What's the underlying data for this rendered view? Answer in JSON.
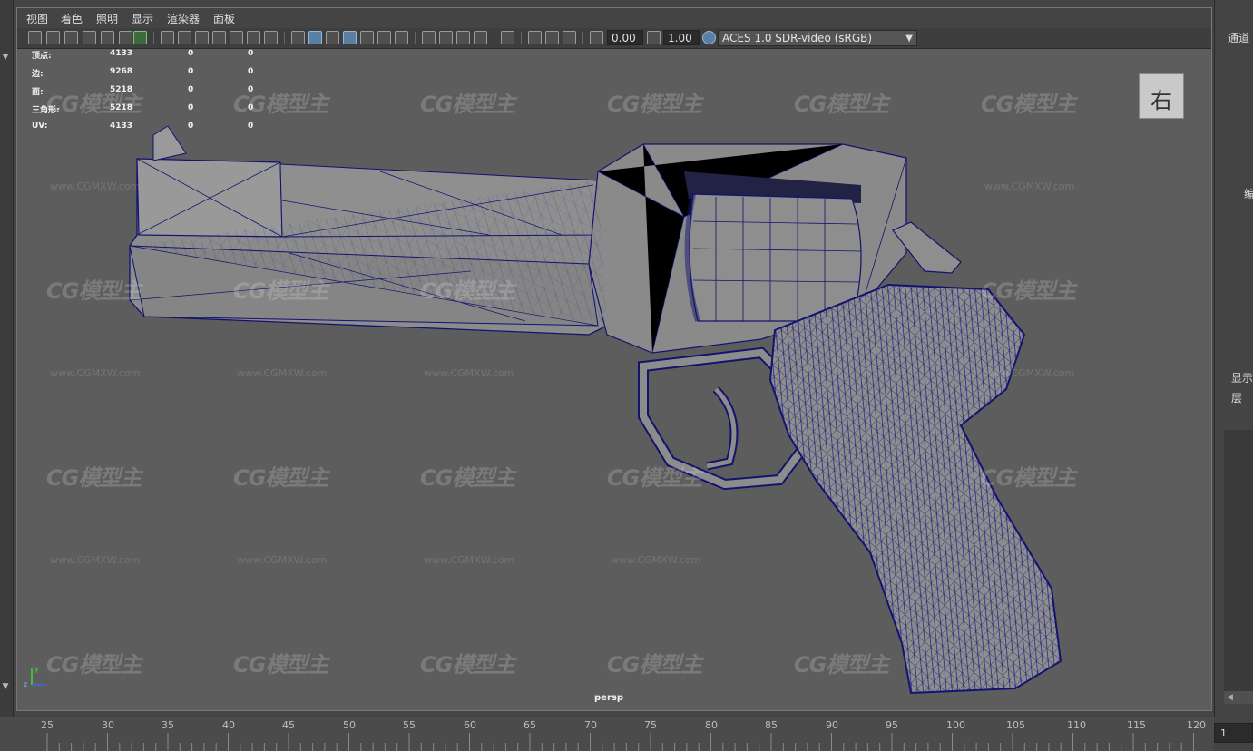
{
  "menu": [
    "视图",
    "着色",
    "照明",
    "显示",
    "渲染器",
    "面板"
  ],
  "toolbar": {
    "exposure_value": "0.00",
    "gamma_value": "1.00",
    "colorspace": "ACES 1.0 SDR-video (sRGB)",
    "icons": [
      "camera-select-icon",
      "camera-attr-icon",
      "bookmark-icon",
      "image-plane-icon",
      "grease-pencil-icon",
      "grid-icon",
      "film-gate-icon",
      "resolution-gate-icon",
      "safe-action-icon",
      "field-chart-icon",
      "wireframe-icon",
      "smooth-shade-icon",
      "wireframe-on-shaded-icon",
      "textured-icon",
      "lights-icon",
      "shadows-icon",
      "ambient-occlusion-icon",
      "motion-blur-icon",
      "isolate-select-icon",
      "xray-icon",
      "exposure-icon",
      "gamma-icon",
      "color-management-icon"
    ]
  },
  "hud": {
    "rows": [
      {
        "label": "顶点:",
        "v1": "4133",
        "v2": "0",
        "v3": "0"
      },
      {
        "label": "边:",
        "v1": "9268",
        "v2": "0",
        "v3": "0"
      },
      {
        "label": "面:",
        "v1": "5218",
        "v2": "0",
        "v3": "0"
      },
      {
        "label": "三角形:",
        "v1": "5218",
        "v2": "0",
        "v3": "0"
      },
      {
        "label": "UV:",
        "v1": "4133",
        "v2": "0",
        "v3": "0"
      }
    ]
  },
  "watermark": {
    "logo": "CG模型主",
    "url": "www.CGMXW.com"
  },
  "viewcube_label": "右",
  "camera_label": "persp",
  "axis": {
    "y": "y",
    "z": "z"
  },
  "right_panel": {
    "channels": "通道",
    "display": "显示",
    "layers": "层",
    "edit": "编"
  },
  "timeline": {
    "ticks": [
      "25",
      "30",
      "35",
      "40",
      "45",
      "50",
      "55",
      "60",
      "65",
      "70",
      "75",
      "80",
      "85",
      "90",
      "95",
      "100",
      "105",
      "110",
      "115",
      "120"
    ],
    "current_frame": "1"
  },
  "colors": {
    "viewport_bg": "#5d5d5d",
    "wire": "#15157a",
    "panel": "#444444"
  }
}
